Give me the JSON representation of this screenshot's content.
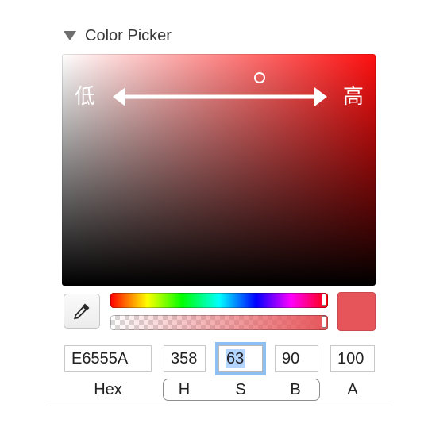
{
  "section": {
    "title": "Color Picker",
    "expanded": true
  },
  "sb_field": {
    "hue_color": "#ff0f0f",
    "annotation_low": "低",
    "annotation_high": "高"
  },
  "eyedropper": {
    "icon": "eyedropper-icon"
  },
  "current_color": "#e6555a",
  "fields": {
    "hex": "E6555A",
    "h": "358",
    "s_selected": "63",
    "b": "90",
    "a": "100"
  },
  "labels": {
    "hex": "Hex",
    "h": "H",
    "s": "S",
    "b": "B",
    "a": "A"
  },
  "colors": {
    "focus_ring": "#8ebff3",
    "selection": "#b4d5fe"
  }
}
